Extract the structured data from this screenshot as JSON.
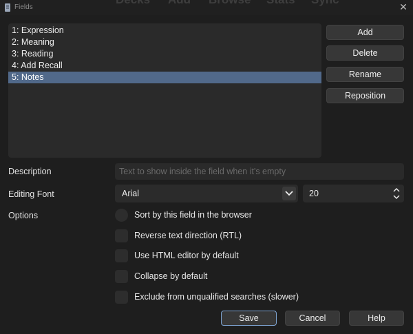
{
  "window": {
    "title": "Fields",
    "background_menu": [
      "Decks",
      "Add",
      "Browse",
      "Stats",
      "Sync"
    ]
  },
  "fields": [
    {
      "label": "1: Expression",
      "selected": false
    },
    {
      "label": "2: Meaning",
      "selected": false
    },
    {
      "label": "3: Reading",
      "selected": false
    },
    {
      "label": "4: Add Recall",
      "selected": false
    },
    {
      "label": "5: Notes",
      "selected": true
    }
  ],
  "side_buttons": {
    "add": "Add",
    "delete": "Delete",
    "rename": "Rename",
    "reposition": "Reposition"
  },
  "description": {
    "label": "Description",
    "value": "",
    "placeholder": "Text to show inside the field when it's empty"
  },
  "editing_font": {
    "label": "Editing Font",
    "font": "Arial",
    "size": "20"
  },
  "options": {
    "label": "Options",
    "sort": {
      "label": "Sort by this field in the browser",
      "checked": false
    },
    "rtl": {
      "label": "Reverse text direction (RTL)",
      "checked": false
    },
    "html_editor": {
      "label": "Use HTML editor by default",
      "checked": false
    },
    "collapse": {
      "label": "Collapse by default",
      "checked": false
    },
    "exclude": {
      "label": "Exclude from unqualified searches (slower)",
      "checked": false
    }
  },
  "dialog_buttons": {
    "save": "Save",
    "cancel": "Cancel",
    "help": "Help"
  },
  "colors": {
    "selection": "#51698a",
    "default_button_border": "#7ea4d2"
  }
}
